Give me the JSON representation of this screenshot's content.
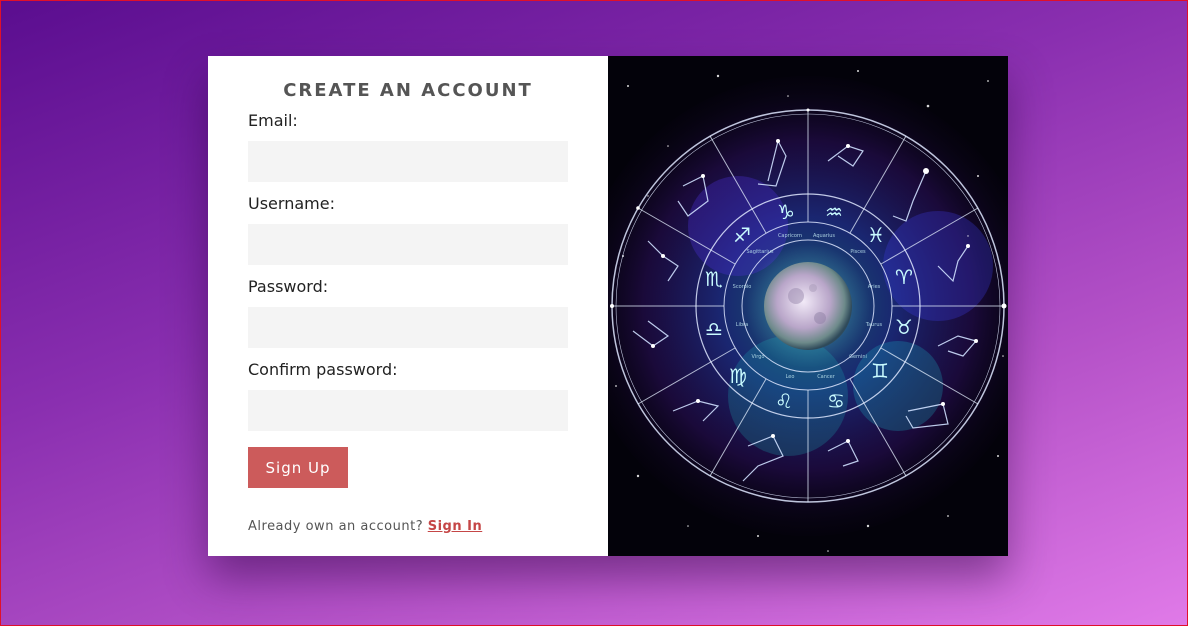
{
  "form": {
    "title": "CREATE AN ACCOUNT",
    "fields": [
      {
        "label": "Email:",
        "value": "",
        "placeholder": ""
      },
      {
        "label": "Username:",
        "value": "",
        "placeholder": ""
      },
      {
        "label": "Password:",
        "value": "",
        "placeholder": ""
      },
      {
        "label": "Confirm password:",
        "value": "",
        "placeholder": ""
      }
    ],
    "submit_label": "Sign Up",
    "footer_text": "Already own an account?",
    "signin_link": "Sign In"
  },
  "image": {
    "wheel_labels": [
      "Aquarius",
      "Capricorn",
      "Sagittarius",
      "Scorpio",
      "Libra",
      "Virgo",
      "Leo",
      "Cancer",
      "Gemini",
      "Taurus",
      "Aries",
      "Pisces"
    ]
  },
  "colors": {
    "accent": "#cc5b5b",
    "input_bg": "#f4f4f4",
    "bg_start": "#5a0d8f",
    "bg_end": "#e07ae8"
  }
}
